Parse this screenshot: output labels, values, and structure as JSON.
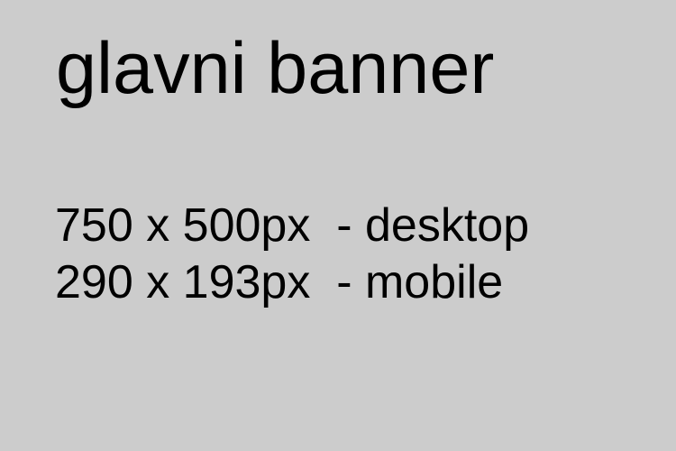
{
  "banner": {
    "title": "glavni banner",
    "lines": [
      "750 x 500px  - desktop",
      "290 x 193px  - mobile"
    ]
  },
  "colors": {
    "background": "#cccccc",
    "text": "#000000"
  }
}
